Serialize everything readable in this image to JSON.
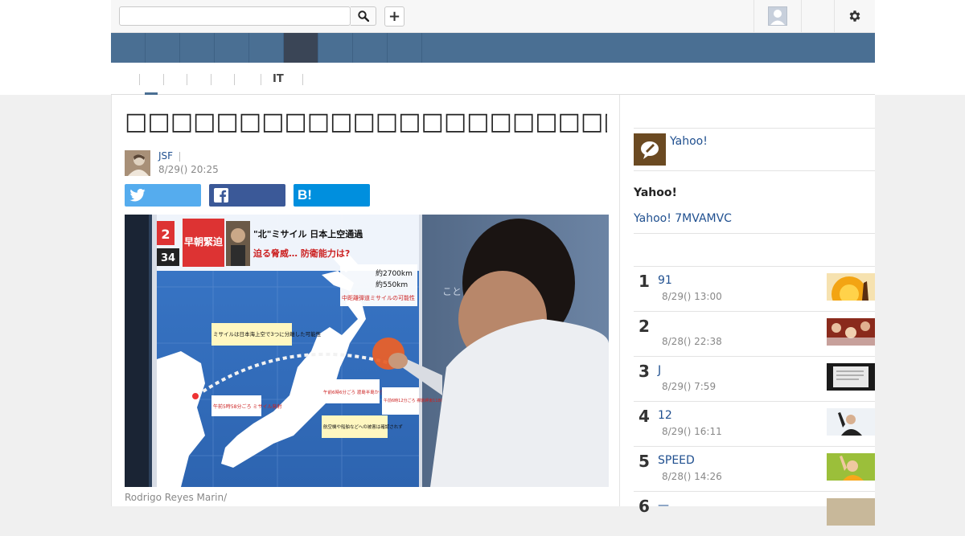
{
  "search": {
    "value": "",
    "placeholder": ""
  },
  "toolbar": {
    "plus_label": "+"
  },
  "article": {
    "headline": "□□□□□□□□□□□□□□□□□□□□□□□Ｊ□□□□□□□□□□□□□",
    "author": "JSF",
    "date": "8/29() 20:25",
    "share": {
      "hatena_label": "B!"
    },
    "photo_caption": "Rodrigo Reyes Marin/"
  },
  "sidebar": {
    "author_link": "Yahoo!",
    "section_title": "Yahoo!",
    "promo_link": "Yahoo! 7MVAMVC",
    "ranking": [
      {
        "rank": "1",
        "title": "91",
        "date": "8/29() 13:00"
      },
      {
        "rank": "2",
        "title": "",
        "date": "8/28() 22:38"
      },
      {
        "rank": "3",
        "title": "J",
        "date": "8/29() 7:59"
      },
      {
        "rank": "4",
        "title": "12",
        "date": "8/29() 16:11"
      },
      {
        "rank": "5",
        "title": "SPEED",
        "date": "8/28() 14:26"
      },
      {
        "rank": "6",
        "title": "—",
        "date": ""
      }
    ]
  },
  "subnav": {
    "items": [
      "",
      "",
      "",
      "",
      "",
      "IT",
      ""
    ]
  },
  "photo": {
    "label_channel": "2",
    "label_number": "34",
    "banner_red": "早朝緊迫",
    "banner_main": "\"北\"ミサイル 日本上空通過",
    "banner_sub": "迫る脅威… 防衛能力は?",
    "range_1": "約2700km",
    "range_2": "約550km",
    "range_label": "中距離弾道ミサイルの可能性",
    "note_split": "ミサイルは日本海上空で3つに分離した可能性",
    "note_launch": "午前5時58分ごろ ミサイル発射",
    "note_pass": "午前6時6分ごろ 渡島半島から上空を通過",
    "note_fall": "午前6時12分ごろ 襟裳岬東1180km落下",
    "note_damage": "航空機や船舶などへの被害は確認されず",
    "place_label": "ことし"
  },
  "colors": {
    "nav": "#4a6f93",
    "nav_active": "#3a4556",
    "twitter": "#55acee",
    "facebook": "#3b5998",
    "hatena": "#008fde",
    "link": "#1f4f8f"
  }
}
